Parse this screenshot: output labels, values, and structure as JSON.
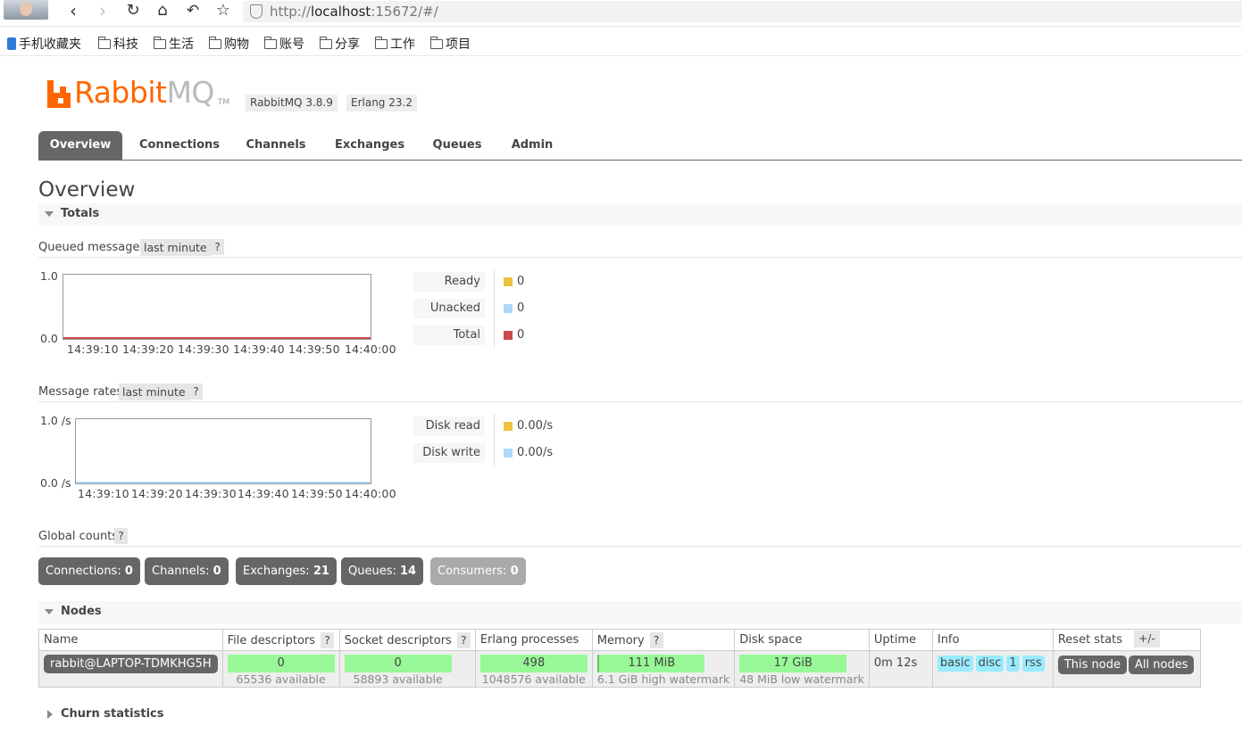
{
  "browser": {
    "url_prefix": "http://",
    "url_host": "localhost",
    "url_rest": ":15672/#/",
    "bookmarks": [
      "手机收藏夹",
      "科技",
      "生活",
      "购物",
      "账号",
      "分享",
      "工作",
      "项目"
    ]
  },
  "header": {
    "logo_rabbit": "Rabbit",
    "logo_mq": "MQ",
    "logo_tm": "TM",
    "version": "RabbitMQ 3.8.9",
    "erlang": "Erlang 23.2"
  },
  "tabs": [
    "Overview",
    "Connections",
    "Channels",
    "Exchanges",
    "Queues",
    "Admin"
  ],
  "page_title": "Overview",
  "totals": {
    "label": "Totals",
    "queued": {
      "label": "Queued messages",
      "range": "last minute",
      "help": "?",
      "y_top": "1.0",
      "y_bottom": "0.0",
      "x_ticks": [
        "14:39:10",
        "14:39:20",
        "14:39:30",
        "14:39:40",
        "14:39:50",
        "14:40:00"
      ],
      "legend": [
        {
          "label": "Ready",
          "value": "0",
          "color": "#edc240"
        },
        {
          "label": "Unacked",
          "value": "0",
          "color": "#afd8f8"
        },
        {
          "label": "Total",
          "value": "0",
          "color": "#cb4b4b"
        }
      ]
    },
    "rates": {
      "label": "Message rates",
      "range": "last minute",
      "help": "?",
      "y_top": "1.0 /s",
      "y_bottom": "0.0 /s",
      "x_ticks": [
        "14:39:10",
        "14:39:20",
        "14:39:30",
        "14:39:40",
        "14:39:50",
        "14:40:00"
      ],
      "legend": [
        {
          "label": "Disk read",
          "value": "0.00/s",
          "color": "#edc240"
        },
        {
          "label": "Disk write",
          "value": "0.00/s",
          "color": "#afd8f8"
        }
      ]
    },
    "global": {
      "label": "Global counts",
      "help": "?",
      "counts": [
        {
          "label": "Connections:",
          "value": "0"
        },
        {
          "label": "Channels:",
          "value": "0"
        },
        {
          "label": "Exchanges:",
          "value": "21"
        },
        {
          "label": "Queues:",
          "value": "14"
        },
        {
          "label": "Consumers:",
          "value": "0"
        }
      ]
    }
  },
  "nodes": {
    "label": "Nodes",
    "toggle": "+/-",
    "columns": [
      "Name",
      "File descriptors",
      "Socket descriptors",
      "Erlang processes",
      "Memory",
      "Disk space",
      "Uptime",
      "Info",
      "Reset stats"
    ],
    "help": "?",
    "row": {
      "name": "rabbit@LAPTOP-TDMKHG5H",
      "fd": "0",
      "fd_avail": "65536 available",
      "sd": "0",
      "sd_avail": "58893 available",
      "erl": "498",
      "erl_avail": "1048576 available",
      "mem": "111 MiB",
      "mem_sub": "6.1 GiB high watermark",
      "disk": "17 GiB",
      "disk_sub": "48 MiB low watermark",
      "uptime": "0m 12s",
      "info": [
        "basic",
        "disc",
        "1",
        "rss"
      ],
      "reset": [
        "This node",
        "All nodes"
      ]
    }
  },
  "churn": {
    "label": "Churn statistics"
  }
}
